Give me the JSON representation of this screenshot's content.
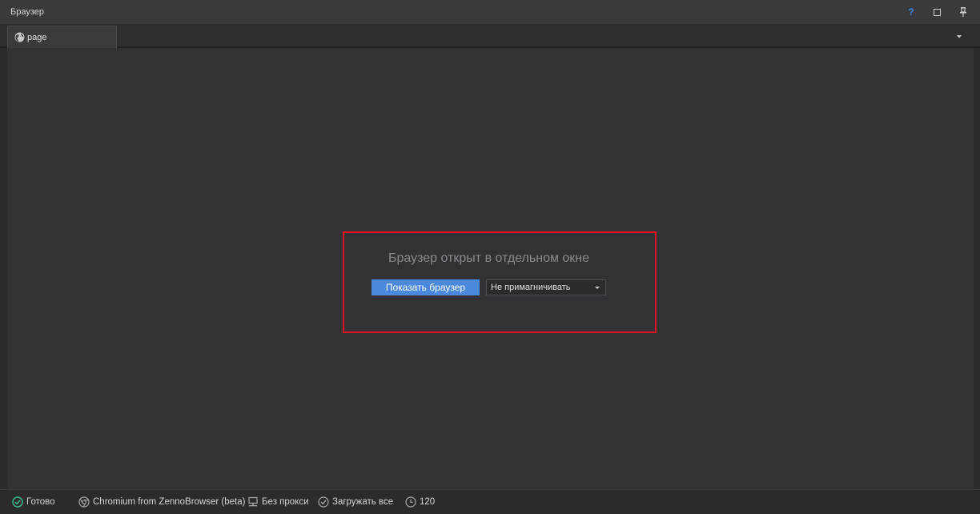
{
  "window": {
    "title": "Браузер"
  },
  "titlebar_buttons": {
    "help_label": "?"
  },
  "tabs": [
    {
      "label": "page",
      "icon": "globe-icon"
    }
  ],
  "content": {
    "message": "Браузер открыт в отдельном окне",
    "show_button_label": "Показать браузер",
    "dock_select": {
      "selected": "Не примагничивать"
    },
    "highlight_color": "#e0141e"
  },
  "statusbar": {
    "status": "Готово",
    "browser_engine": "Chromium from ZennoBrowser (beta)",
    "proxy": "Без прокси",
    "load_mode": "Загружать все",
    "timeout": "120"
  },
  "colors": {
    "accent": "#4a89dc",
    "help": "#3f8ae0",
    "status_ok": "#3cbf8f"
  }
}
